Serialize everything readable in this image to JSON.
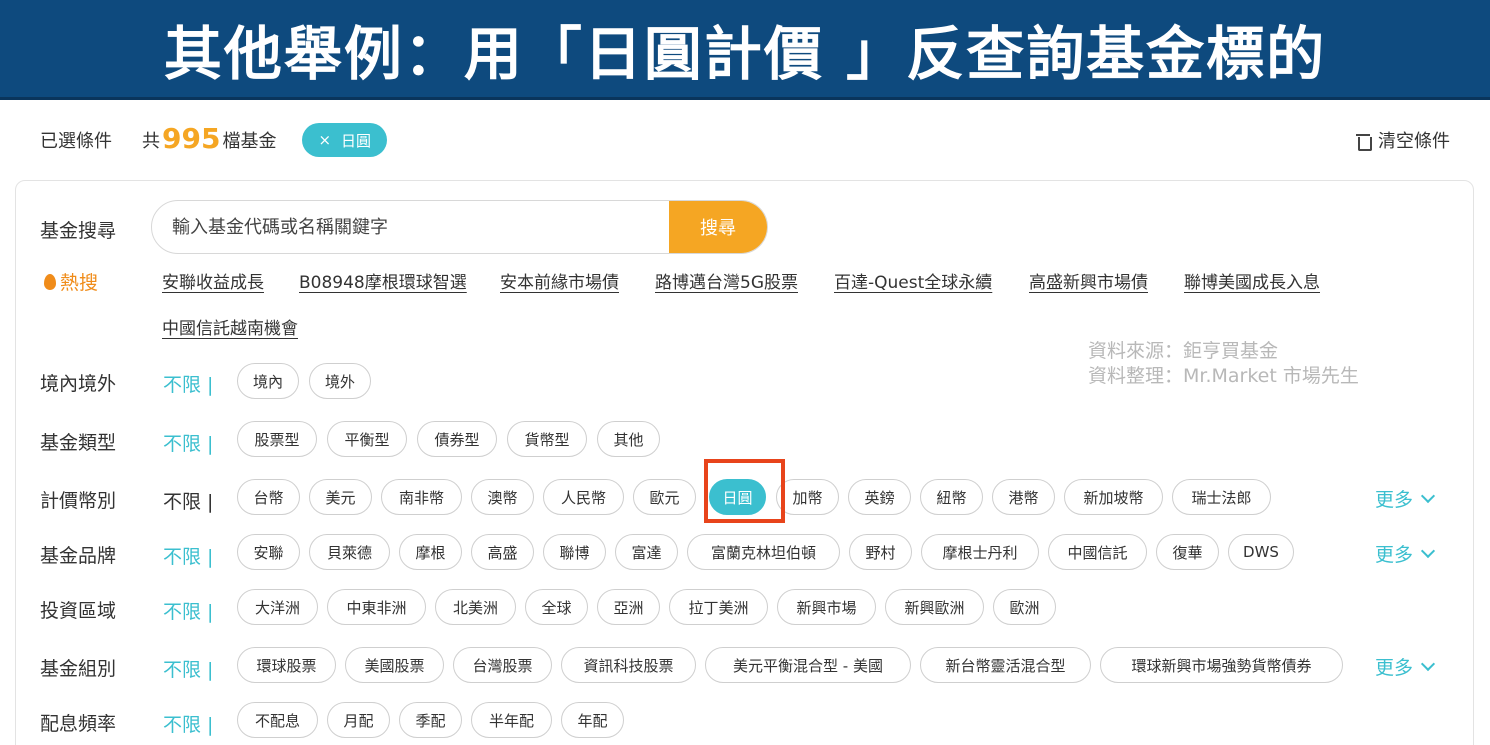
{
  "banner": {
    "title": "其他舉例：用「日圓計價 」反查詢基金標的"
  },
  "selected": {
    "label": "已選條件",
    "count_prefix": "共",
    "count": "995",
    "count_suffix": "檔基金",
    "tag_x": "×",
    "tag": "日圓",
    "clear": "清空條件"
  },
  "search": {
    "label": "基金搜尋",
    "placeholder": "輸入基金代碼或名稱關鍵字",
    "button": "搜尋"
  },
  "hot": {
    "label": "熱搜",
    "links": [
      "安聯收益成長",
      "B08948摩根環球智選",
      "安本前緣市場債",
      "路博邁台灣5G股票",
      "百達-Quest全球永續",
      "高盛新興市場債",
      "聯博美國成長入息",
      "中國信託越南機會"
    ]
  },
  "watermark": {
    "line1": "資料來源：鉅亨買基金",
    "line2": "資料整理：Mr.Market 市場先生"
  },
  "filters": {
    "unlimited": "不限",
    "pipe": "|",
    "more": "更多",
    "region": {
      "label": "境內境外",
      "options": [
        "境內",
        "境外"
      ]
    },
    "type": {
      "label": "基金類型",
      "options": [
        "股票型",
        "平衡型",
        "債券型",
        "貨幣型",
        "其他"
      ]
    },
    "currency": {
      "label": "計價幣別",
      "options": [
        "台幣",
        "美元",
        "南非幣",
        "澳幣",
        "人民幣",
        "歐元",
        "日圓",
        "加幣",
        "英鎊",
        "紐幣",
        "港幣",
        "新加坡幣",
        "瑞士法郎"
      ],
      "selected": "日圓"
    },
    "brand": {
      "label": "基金品牌",
      "options": [
        "安聯",
        "貝萊德",
        "摩根",
        "高盛",
        "聯博",
        "富達",
        "富蘭克林坦伯頓",
        "野村",
        "摩根士丹利",
        "中國信託",
        "復華",
        "DWS"
      ]
    },
    "area": {
      "label": "投資區域",
      "options": [
        "大洋洲",
        "中東非洲",
        "北美洲",
        "全球",
        "亞洲",
        "拉丁美洲",
        "新興市場",
        "新興歐洲",
        "歐洲"
      ]
    },
    "group": {
      "label": "基金組別",
      "options": [
        "環球股票",
        "美國股票",
        "台灣股票",
        "資訊科技股票",
        "美元平衡混合型 - 美國",
        "新台幣靈活混合型",
        "環球新興市場強勢貨幣債券"
      ]
    },
    "dividend": {
      "label": "配息頻率",
      "options": [
        "不配息",
        "月配",
        "季配",
        "半年配",
        "年配"
      ]
    }
  },
  "colors": {
    "accent": "#3bbfcf",
    "orange": "#f5a623",
    "banner": "#0e4a7e",
    "highlight": "#e8441b"
  }
}
